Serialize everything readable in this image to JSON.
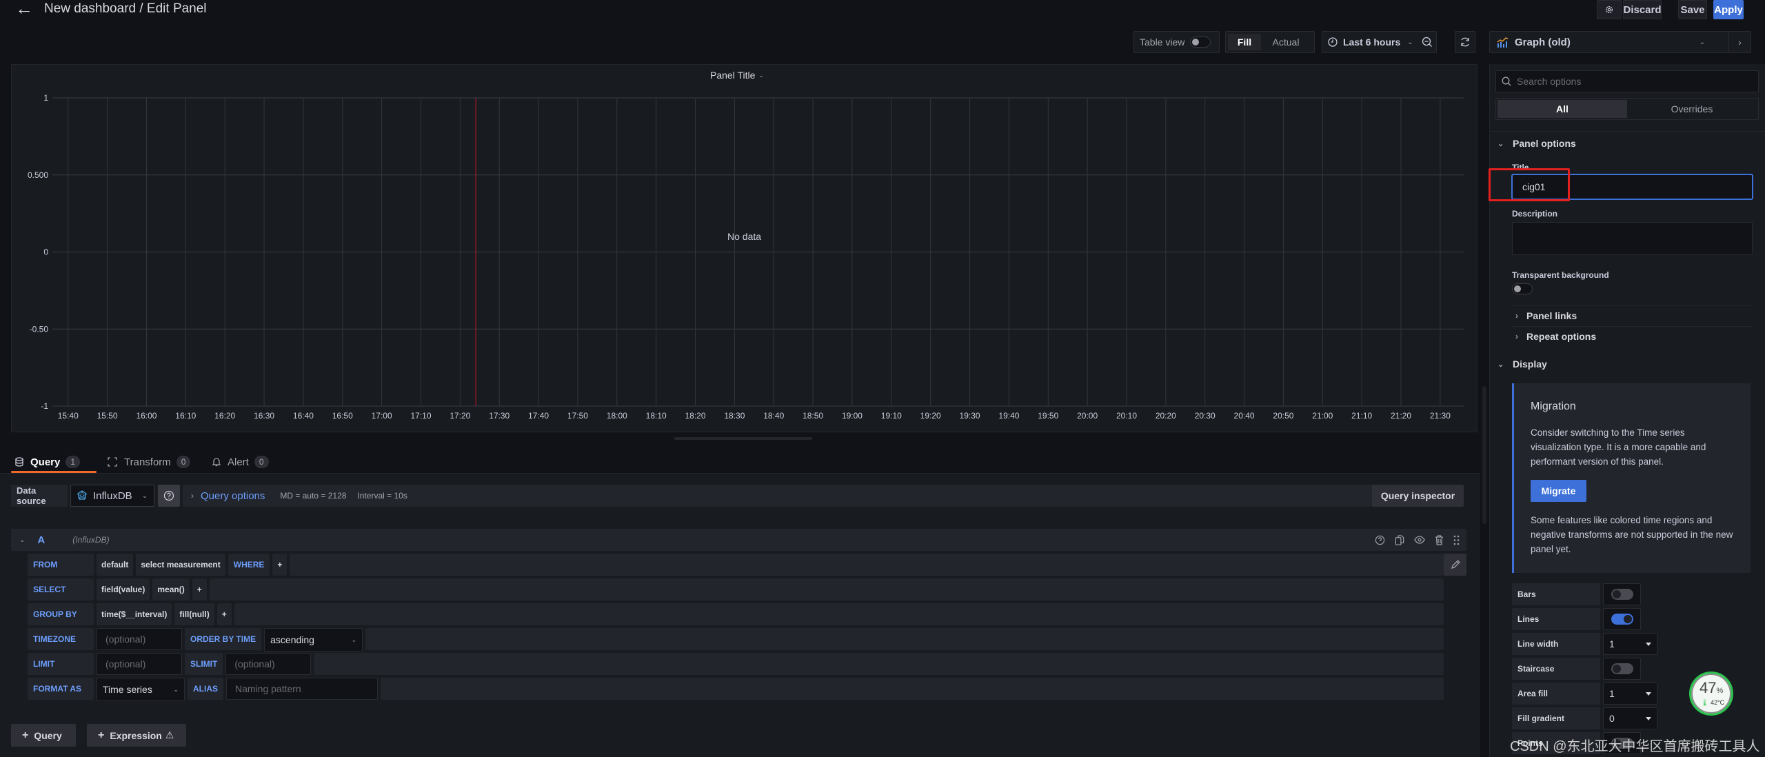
{
  "header": {
    "back_icon": "arrow-left-icon",
    "title": "New dashboard / Edit Panel",
    "discard_label": "Discard",
    "save_label": "Save",
    "apply_label": "Apply",
    "settings_icon": "gear-icon",
    "accent_color": "#3d71d9"
  },
  "toolbar": {
    "table_view_label": "Table view",
    "table_view_on": false,
    "fill_label": "Fill",
    "actual_label": "Actual",
    "time_range": "Last 6 hours",
    "viz_type": "Graph (old)"
  },
  "panel": {
    "title": "Panel Title",
    "no_data": "No data"
  },
  "chart_data": {
    "type": "line",
    "title": "Panel Title",
    "xlabel": "",
    "ylabel": "",
    "series": [],
    "x_ticks": [
      "15:40",
      "15:50",
      "16:00",
      "16:10",
      "16:20",
      "16:30",
      "16:40",
      "16:50",
      "17:00",
      "17:10",
      "17:20",
      "17:30",
      "17:40",
      "17:50",
      "18:00",
      "18:10",
      "18:20",
      "18:30",
      "18:40",
      "18:50",
      "19:00",
      "19:10",
      "19:20",
      "19:30",
      "19:40",
      "19:50",
      "20:00",
      "20:10",
      "20:20",
      "20:30",
      "20:40",
      "20:50",
      "21:00",
      "21:10",
      "21:20",
      "21:30"
    ],
    "y_ticks": [
      "1",
      "0.500",
      "0",
      "-0.50",
      "-1"
    ],
    "y_tick_values": [
      1,
      0.5,
      0,
      -0.5,
      -1
    ],
    "ylim": [
      -1,
      1
    ],
    "xlim_minutes": [
      -4,
      356
    ],
    "grid": true,
    "annotation_marker_time": "17:24",
    "annotation_color": "#c4162a",
    "empty_message": "No data"
  },
  "tabs": [
    {
      "label": "Query",
      "count": "1",
      "active": true
    },
    {
      "label": "Transform",
      "count": "0",
      "active": false
    },
    {
      "label": "Alert",
      "count": "0",
      "active": false
    }
  ],
  "datasource": {
    "label": "Data source",
    "selected": "InfluxDB",
    "query_options_label": "Query options",
    "md": "MD = auto = 2128",
    "interval": "Interval = 10s",
    "query_inspector_label": "Query inspector"
  },
  "query_a": {
    "ref_id": "A",
    "datasource": "(InfluxDB)",
    "from": {
      "keyword": "FROM",
      "policy": "default",
      "measurement": "select measurement",
      "where": "WHERE",
      "plus": "+"
    },
    "select": {
      "keyword": "SELECT",
      "field": "field(value)",
      "fn": "mean()",
      "plus": "+"
    },
    "group_by": {
      "keyword": "GROUP BY",
      "time": "time($__interval)",
      "fill": "fill(null)",
      "plus": "+"
    },
    "timezone": {
      "keyword": "TIMEZONE",
      "placeholder": "(optional)",
      "order_keyword": "ORDER BY TIME",
      "order_value": "ascending"
    },
    "limit": {
      "keyword": "LIMIT",
      "placeholder": "(optional)",
      "slimit_keyword": "SLIMIT",
      "slimit_placeholder": "(optional)"
    },
    "format": {
      "keyword": "FORMAT AS",
      "value": "Time series",
      "alias_keyword": "ALIAS",
      "alias_placeholder": "Naming pattern"
    }
  },
  "add_buttons": {
    "query": "Query",
    "expression": "Expression"
  },
  "options": {
    "search_placeholder": "Search options",
    "tab_all": "All",
    "tab_overrides": "Overrides",
    "panel_options": {
      "heading": "Panel options",
      "title_label": "Title",
      "title_value": "cig01",
      "description_label": "Description",
      "description_value": "",
      "transparent_label": "Transparent background",
      "transparent_on": false,
      "panel_links": "Panel links",
      "repeat_options": "Repeat options"
    },
    "display": {
      "heading": "Display",
      "migration_title": "Migration",
      "migration_body": "Consider switching to the Time series visualization type. It is a more capable and performant version of this panel.",
      "migrate_button": "Migrate",
      "migration_note": "Some features like colored time regions and negative transforms are not supported in the new panel yet.",
      "rows": [
        {
          "label": "Bars",
          "type": "toggle",
          "on": false
        },
        {
          "label": "Lines",
          "type": "toggle",
          "on": true
        },
        {
          "label": "Line width",
          "type": "select",
          "value": "1"
        },
        {
          "label": "Staircase",
          "type": "toggle",
          "on": false
        },
        {
          "label": "Area fill",
          "type": "select",
          "value": "1"
        },
        {
          "label": "Fill gradient",
          "type": "select",
          "value": "0"
        },
        {
          "label": "Points",
          "type": "toggle",
          "on": false
        }
      ]
    }
  },
  "overlay": {
    "cpu_percent": "47",
    "percent_sign": "%",
    "temperature": "42°C",
    "watermark": "CSDN @东北亚大中华区首席搬砖工具人"
  }
}
